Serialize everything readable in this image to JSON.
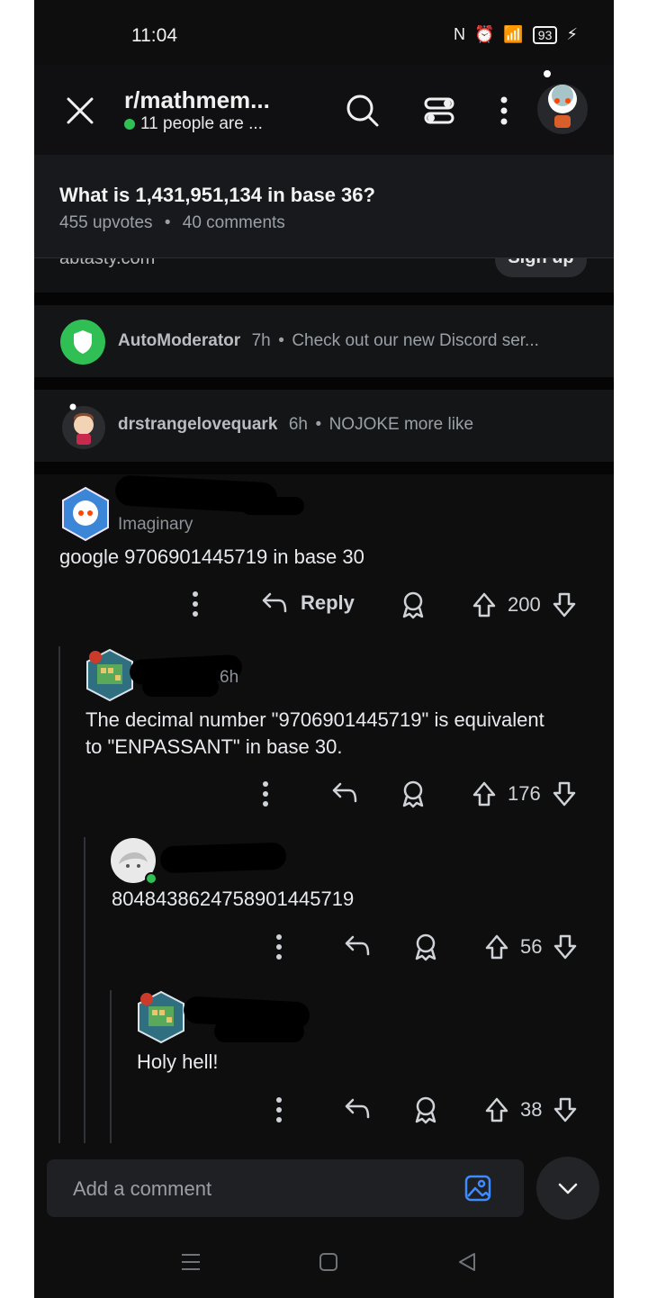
{
  "status": {
    "time": "11:04",
    "battery": "93"
  },
  "header": {
    "subreddit": "r/mathmem...",
    "online": "11 people are ..."
  },
  "post": {
    "title": "What is 1,431,951,134 in base 36?",
    "upvotes": "455 upvotes",
    "dot": "•",
    "comments": "40 comments"
  },
  "ad": {
    "domain": "abtasty.com",
    "cta": "Sign up"
  },
  "collapsed": [
    {
      "author": "AutoModerator",
      "time": "7h",
      "dot": "•",
      "preview": "Check out our new Discord ser..."
    },
    {
      "author": "drstrangelovequark",
      "time": "6h",
      "dot": "•",
      "preview": "NOJOKE more like"
    }
  ],
  "comments": [
    {
      "flair": "Imaginary",
      "text": "google 9706901445719 in base 30",
      "reply_label": "Reply",
      "score": "200"
    },
    {
      "time": "6h",
      "text": "The decimal number \"9706901445719\" is equivalent to \"ENPASSANT\" in base 30.",
      "score": "176"
    },
    {
      "text": "80484386247589014457 19",
      "text_full": "8048438624758901445719",
      "score": "56"
    },
    {
      "text": "Holy hell!",
      "score": "38"
    }
  ],
  "composer": {
    "placeholder": "Add a comment"
  },
  "colors": {
    "background": "#0e0e0f",
    "online_green": "#2fbf55",
    "automod_green": "#2fbf55",
    "link_blue": "#3d8bff"
  }
}
